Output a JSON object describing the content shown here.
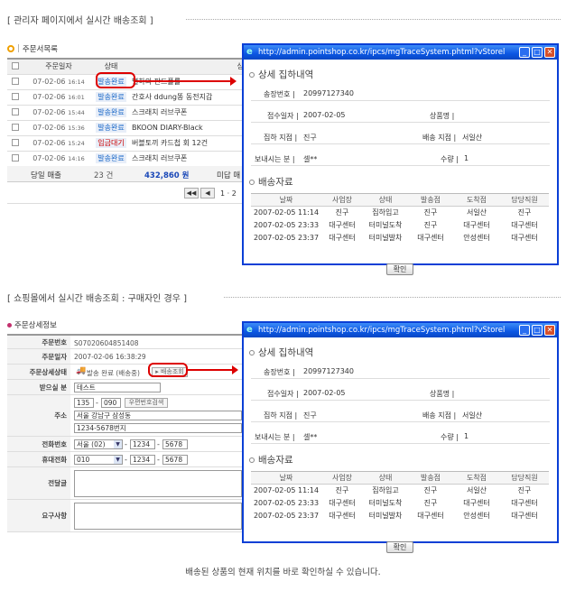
{
  "section1": {
    "title": "[ 관리자 페이지에서 실시간 배송조회 ]"
  },
  "section2": {
    "title": "[ 쇼핑몰에서 실시간 배송조회 : 구매자인 경우 ]"
  },
  "order_list": {
    "header": "주문서목록",
    "columns": [
      "주문일자",
      "상태",
      "상"
    ],
    "rows": [
      {
        "date": "07-02-06",
        "time": "16:14",
        "status": "발송완료",
        "product": "별하의 판드폴를"
      },
      {
        "date": "07-02-06",
        "time": "16:01",
        "status": "발송완료",
        "product": "간호사 ddung똥 동전지갑"
      },
      {
        "date": "07-02-06",
        "time": "15:44",
        "status": "발송완료",
        "product": "스크래치 러브쿠폰"
      },
      {
        "date": "07-02-06",
        "time": "15:36",
        "status": "발송완료",
        "product": "BKOON DIARY-Black"
      },
      {
        "date": "07-02-06",
        "time": "15:24",
        "status": "입금대기",
        "product": "버블토끼 카드첩 회 12건"
      },
      {
        "date": "07-02-06",
        "time": "14:16",
        "status": "발송완료",
        "product": "스크래치 러브쿠폰"
      }
    ],
    "summary": {
      "label": "당일 매출",
      "count": "23 건",
      "amount": "432,860 원",
      "unpaid_label": "미답 매"
    },
    "pager": {
      "first": "◀◀",
      "prev": "◀",
      "page_text": "1 · 2"
    }
  },
  "popup": {
    "window_title": "http://admin.pointshop.co.kr/ipcs/mgTraceSystem.phtml?vStorel",
    "section_title": "상세 집하내역",
    "fields": {
      "invoice_label": "송장번호 |",
      "invoice_value": "20997127340",
      "received_label": "접수일자 |",
      "received_value": "2007-02-05",
      "product_label": "상품명 |",
      "product_value": "",
      "pickup_label": "집하 지점 |",
      "pickup_value": "진구",
      "delivery_label": "배송 지점 |",
      "delivery_value": "서일산",
      "sender_label": "보내시는 분 |",
      "sender_value": "셀**",
      "qty_label": "수량 |",
      "qty_value": "1"
    },
    "trace_title": "배송자료",
    "trace_columns": [
      "날짜",
      "사업장",
      "상태",
      "발송점",
      "도착점",
      "담당직원"
    ],
    "popup1_rows": [
      [
        "2007-02-05 11:14",
        "진구",
        "집하입고",
        "진구",
        "서일산",
        "진구"
      ],
      [
        "2007-02-05 23:33",
        "대구센터",
        "터미널도착",
        "진구",
        "대구센터",
        "대구센터"
      ],
      [
        "2007-02-05 23:37",
        "대구센터",
        "터미널발차",
        "대구센터",
        "안성센터",
        "대구센터"
      ]
    ],
    "popup2_rows": [
      [
        "2007-02-05 11:14",
        "진구",
        "집하입고",
        "진구",
        "서일산",
        "진구"
      ],
      [
        "2007-02-05 23:33",
        "대구센터",
        "터미널도착",
        "진구",
        "대구센터",
        "대구센터"
      ],
      [
        "2007-02-05 23:37",
        "대구센터",
        "터미널발차",
        "대구센터",
        "안성센터",
        "대구센터"
      ]
    ],
    "ok_label": "확인"
  },
  "order_detail": {
    "header": "주문상세정보",
    "order_no_label": "주문번호",
    "order_no": "S07020604851408",
    "order_date_label": "주문일자",
    "order_date": "2007-02-06 16:38:29",
    "status_label": "주문상세상태",
    "status_value": "발송 완료 (배송중)",
    "track_button": "▸ 배송조회",
    "recipient_label": "받으실 분",
    "recipient": "테스트",
    "address_label": "주소",
    "zip1": "135",
    "zip2": "090",
    "zip_button": "우편번호검색",
    "address1": "서울 강남구 삼성동",
    "address2": "1234-5678번지",
    "phone_label": "전화번호",
    "phone_area": "서울 (02)",
    "phone_mid": "1234",
    "phone_last": "5678",
    "mobile_label": "휴대전화",
    "mobile_area": "010",
    "mobile_mid": "1234",
    "mobile_last": "5678",
    "message_label": "전달글",
    "request_label": "요구사항"
  },
  "footer_note": "배송된 상품의 현재 위치를 바로 확인하실 수 있습니다."
}
